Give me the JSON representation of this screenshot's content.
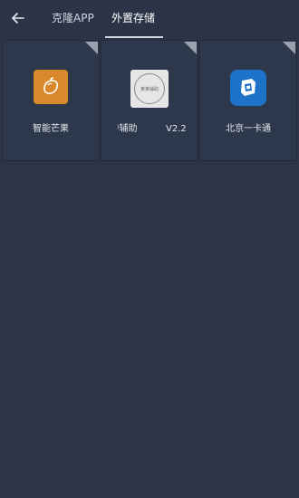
{
  "header": {
    "back_icon": "arrow-left-icon",
    "tabs": [
      {
        "label": "克隆APP",
        "active": false
      },
      {
        "label": "外置存储",
        "active": true
      }
    ]
  },
  "apps": [
    {
      "name": "智能芒果",
      "icon": "mango-icon",
      "color": "#d9892b"
    },
    {
      "name": "辅助",
      "version": "V2.2",
      "icon": "helper-badge-icon",
      "badge_text": "某某辅助",
      "color": "#e6e6e6"
    },
    {
      "name": "北京一卡通",
      "icon": "beijing-card-icon",
      "color": "#1e73c8"
    }
  ],
  "colors": {
    "background": "#2c3548",
    "accent": "#cfd5df"
  }
}
